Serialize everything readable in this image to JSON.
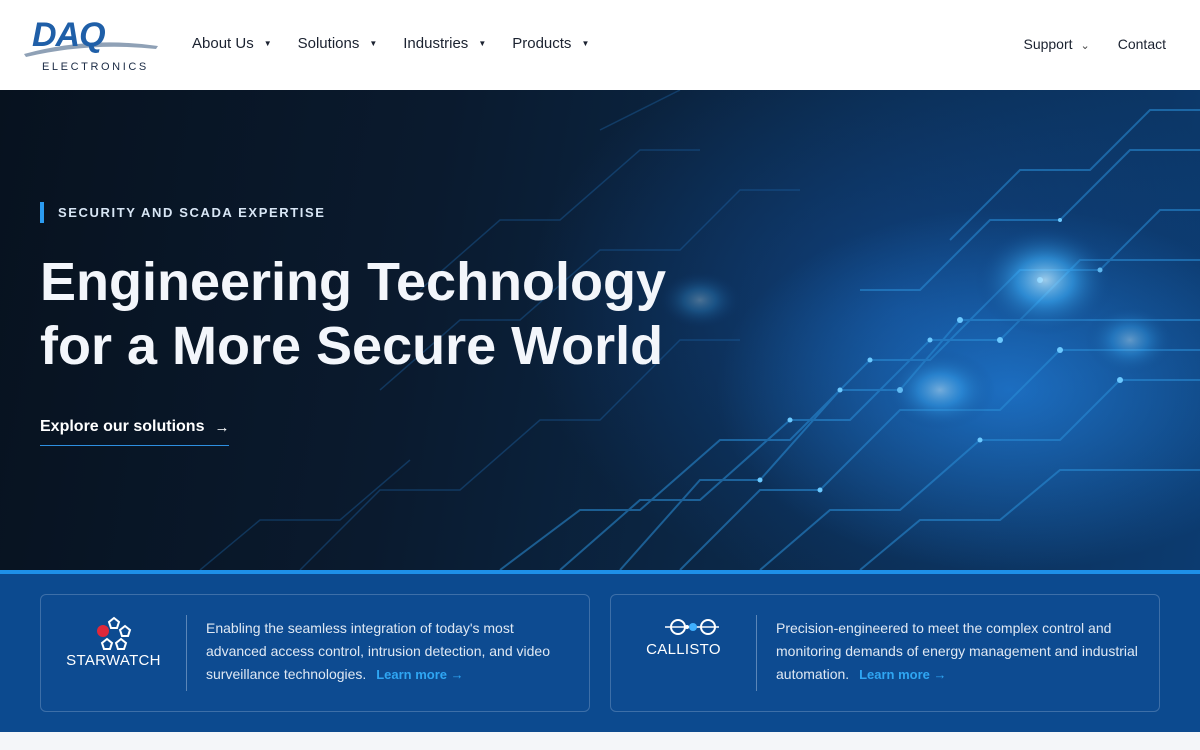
{
  "brand": {
    "logo_text": "DAQ",
    "logo_sub": "ELECTRONICS",
    "accent": "#1e90e8",
    "navy": "#0c4a8f"
  },
  "nav": {
    "items": [
      {
        "label": "About Us"
      },
      {
        "label": "Solutions"
      },
      {
        "label": "Industries"
      },
      {
        "label": "Products"
      }
    ],
    "support_label": "Support",
    "contact_label": "Contact"
  },
  "hero": {
    "eyebrow": "SECURITY AND SCADA EXPERTISE",
    "title_line1": "Engineering Technology",
    "title_line2": "for a More Secure World",
    "cta_label": "Explore our solutions",
    "cta_arrow": "→"
  },
  "products": [
    {
      "name": "STARWATCH",
      "icon": "starwatch-logo-icon",
      "description": "Enabling the seamless integration of today's most advanced access control, intrusion detection, and video surveillance technologies.",
      "link_label": "Learn more →"
    },
    {
      "name": "CALLISTO",
      "icon": "callisto-logo-icon",
      "description": "Precision-engineered to meet the complex control and monitoring demands of energy management and industrial automation.",
      "link_label": "Learn more →"
    }
  ]
}
